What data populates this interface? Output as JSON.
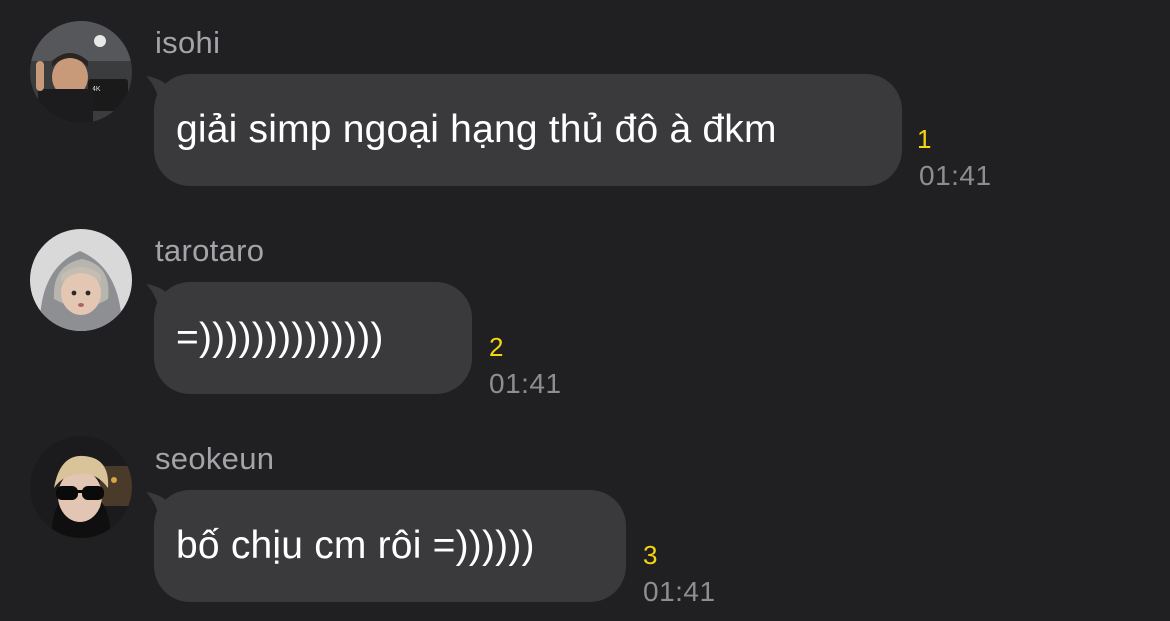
{
  "messages": [
    {
      "sender": "isohi",
      "text": "giải simp ngoại hạng thủ đô à đkm",
      "read_count": "1",
      "time": "01:41",
      "avatar_icon": "avatar-isohi"
    },
    {
      "sender": "tarotaro",
      "text": "=))))))))))))))",
      "read_count": "2",
      "time": "01:41",
      "avatar_icon": "avatar-tarotaro"
    },
    {
      "sender": "seokeun",
      "text": "bố chịu cm rôi =))))))",
      "read_count": "3",
      "time": "01:41",
      "avatar_icon": "avatar-seokeun"
    }
  ],
  "colors": {
    "background": "#202022",
    "bubble": "#3a3a3c",
    "read_count": "#f5d60e",
    "meta": "#8d8d92"
  }
}
